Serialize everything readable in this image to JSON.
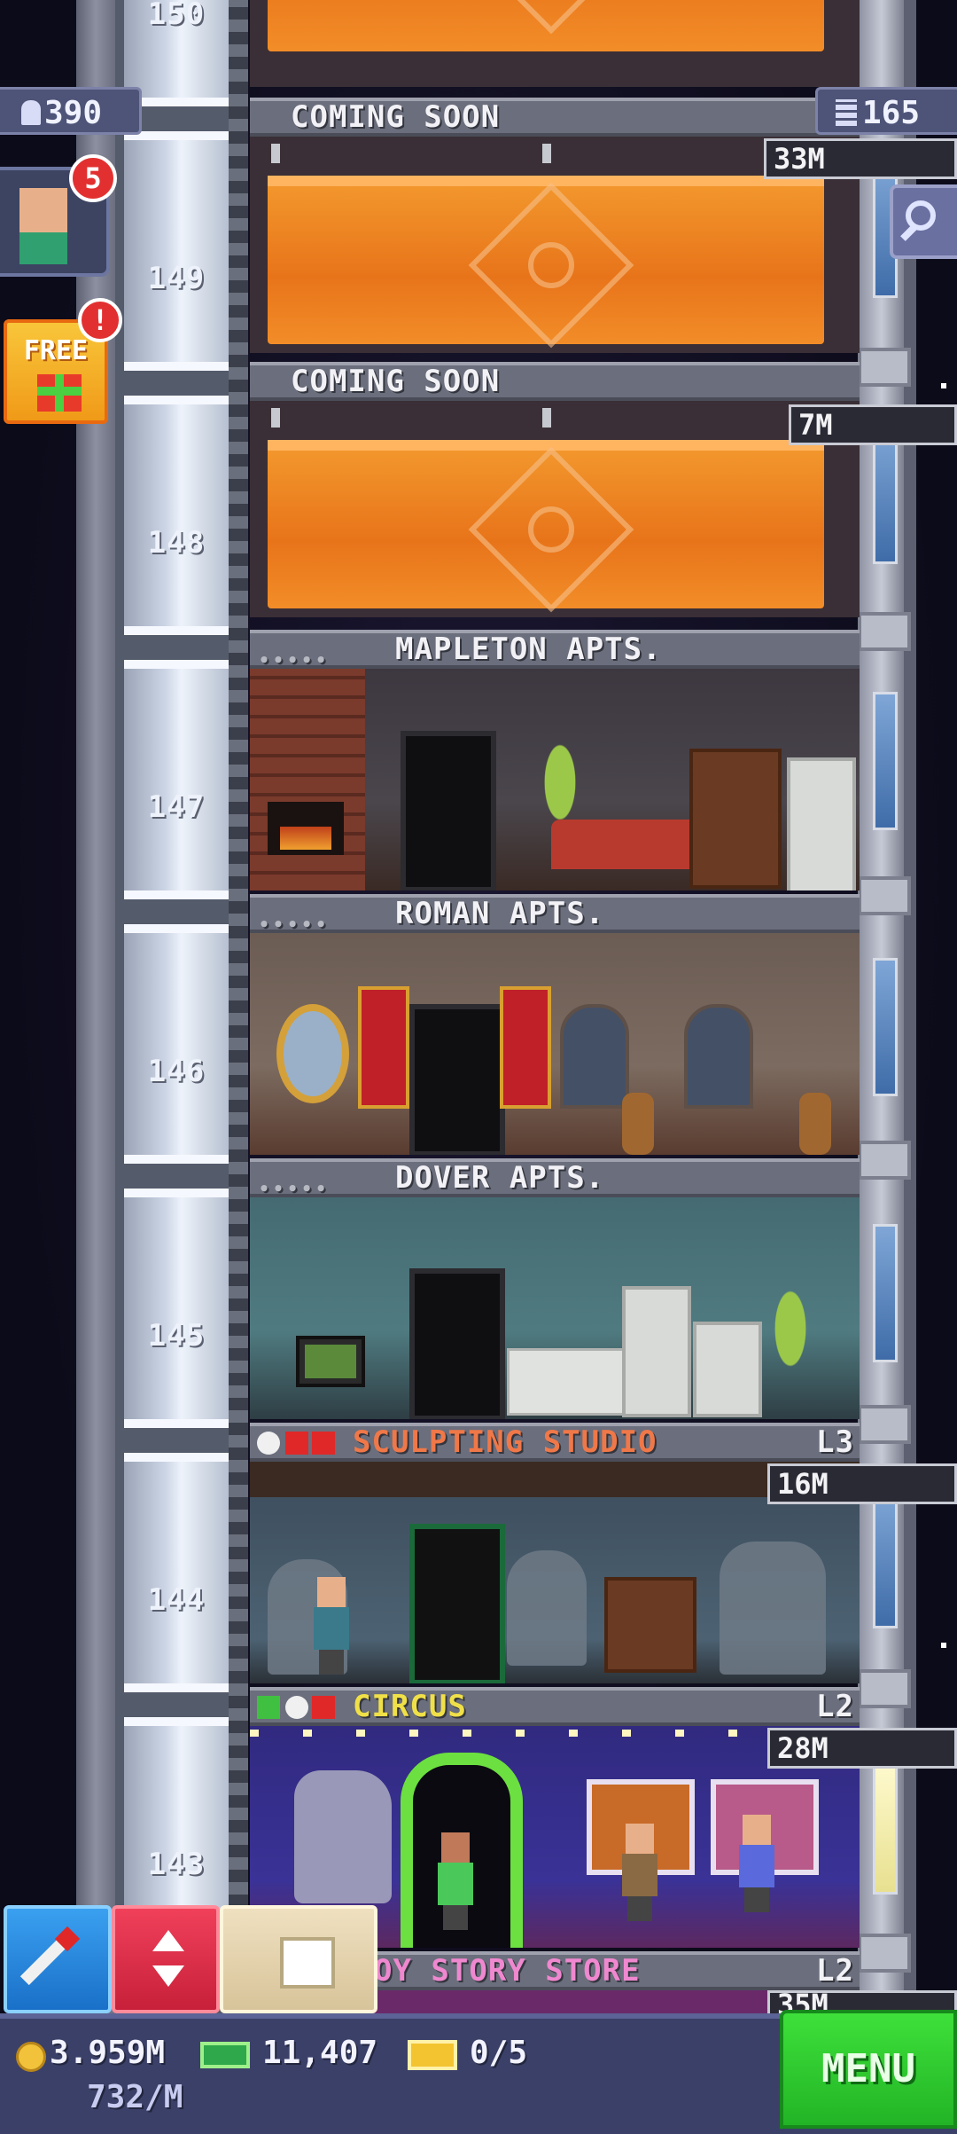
{
  "hud": {
    "population": "390",
    "floors": "165",
    "notifications_badge": "5",
    "free_label": "FREE",
    "free_badge": "!"
  },
  "shaft_floor_numbers": [
    "150",
    "149",
    "148",
    "147",
    "146",
    "145",
    "144",
    "143"
  ],
  "floors": [
    {
      "label": "COMING SOON",
      "price": "33M",
      "type": "construction"
    },
    {
      "label": "COMING SOON",
      "price": "7M",
      "type": "construction"
    },
    {
      "label": "MAPLETON APTS.",
      "stars": "•••••",
      "type": "apartment"
    },
    {
      "label": "ROMAN APTS.",
      "stars": "•••••",
      "type": "apartment"
    },
    {
      "label": "DOVER APTS.",
      "stars": "•••••",
      "type": "apartment"
    },
    {
      "label": "SCULPTING STUDIO",
      "level": "L3",
      "price": "16M",
      "type": "business",
      "label_color": "#f07848"
    },
    {
      "label": "CIRCUS",
      "level": "L2",
      "price": "28M",
      "type": "business",
      "label_color": "#f0e048"
    },
    {
      "label": "OY STORY STORE",
      "level": "L2",
      "price": "35M",
      "type": "business",
      "label_color": "#f088d0"
    }
  ],
  "bottom": {
    "coins": "3.959M",
    "income": "732/M",
    "bux": "11,407",
    "tickets": "0/5",
    "menu_label": "MENU"
  },
  "colors": {
    "menu_green": "#2ec832",
    "bar_bg": "#3b4068",
    "construction_orange": "#f08a26"
  },
  "icons": [
    "elevator-icon",
    "people-icon",
    "floors-icon",
    "search-icon",
    "gift-icon",
    "clock-icon",
    "check-icon",
    "x-icon",
    "coin-icon",
    "bux-icon",
    "ticket-icon",
    "rocket-icon",
    "updown-icon",
    "box-icon"
  ]
}
